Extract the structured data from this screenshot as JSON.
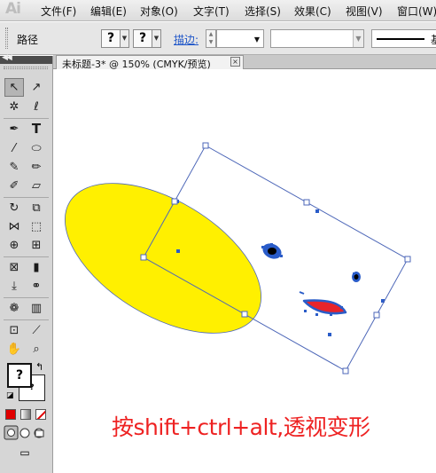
{
  "app": {
    "logo": "Ai"
  },
  "menu": [
    "文件(F)",
    "编辑(E)",
    "对象(O)",
    "文字(T)",
    "选择(S)",
    "效果(C)",
    "视图(V)",
    "窗口(W)"
  ],
  "control_bar": {
    "selection_label": "路径",
    "fill_value": "?",
    "stroke_value": "?",
    "stroke_link": "描边:",
    "brush_label": "基"
  },
  "document": {
    "tab_title": "未标题-3* @ 150% (CMYK/预览)",
    "close_glyph": "×"
  },
  "tools": {
    "fill_stroke_value": "?",
    "stroke_mark": "?"
  },
  "caption": "按shift+ctrl+alt,透视变形",
  "colors": {
    "face_fill": "#fff000",
    "mouth_fill": "#e8242a",
    "selection_blue": "#2a5cc8",
    "caption_red": "#ee2222"
  },
  "icons": [
    "selection-icon",
    "direct-selection-icon",
    "magic-wand-icon",
    "lasso-icon",
    "pen-icon",
    "type-icon",
    "line-icon",
    "ellipse-icon",
    "paintbrush-icon",
    "pencil-icon",
    "blob-brush-icon",
    "eraser-icon",
    "rotate-icon",
    "scale-icon",
    "width-icon",
    "free-transform-icon",
    "shape-builder-icon",
    "perspective-grid-icon",
    "mesh-icon",
    "gradient-icon",
    "eyedropper-icon",
    "blend-icon",
    "symbol-sprayer-icon",
    "column-graph-icon",
    "artboard-icon",
    "slice-icon",
    "hand-icon",
    "zoom-icon"
  ]
}
